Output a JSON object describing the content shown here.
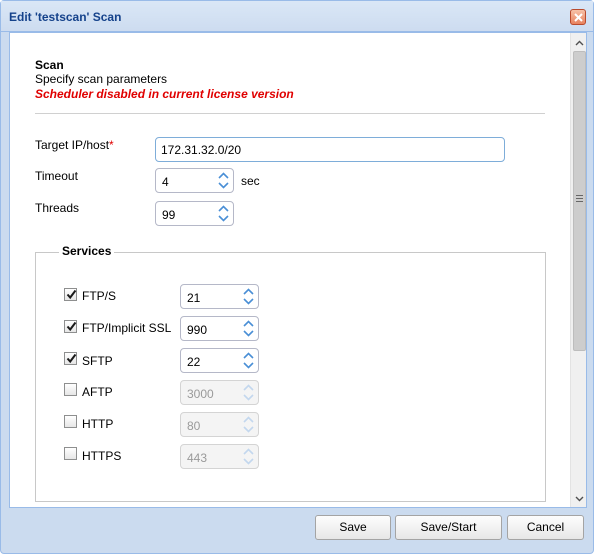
{
  "window": {
    "title": "Edit 'testscan' Scan"
  },
  "header": {
    "heading": "Scan",
    "description": "Specify scan parameters",
    "warning": "Scheduler disabled in current license version"
  },
  "fields": {
    "target_label": "Target IP/host",
    "target_required": "*",
    "target_value": "172.31.32.0/20",
    "timeout_label": "Timeout",
    "timeout_value": "4",
    "timeout_unit": "sec",
    "threads_label": "Threads",
    "threads_value": "99"
  },
  "services": {
    "legend": "Services",
    "items": [
      {
        "label": "FTP/S",
        "checked": true,
        "port": "21",
        "enabled": true
      },
      {
        "label": "FTP/Implicit SSL",
        "checked": true,
        "port": "990",
        "enabled": true
      },
      {
        "label": "SFTP",
        "checked": true,
        "port": "22",
        "enabled": true
      },
      {
        "label": "AFTP",
        "checked": false,
        "port": "3000",
        "enabled": false
      },
      {
        "label": "HTTP",
        "checked": false,
        "port": "80",
        "enabled": false
      },
      {
        "label": "HTTPS",
        "checked": false,
        "port": "443",
        "enabled": false
      }
    ]
  },
  "buttons": {
    "save": "Save",
    "save_start": "Save/Start",
    "cancel": "Cancel"
  },
  "colors": {
    "title_text": "#15428b",
    "warning_text": "#e00000",
    "border_accent": "#99bbe8",
    "spinner_arrow": "#4a8fd6"
  },
  "icons": {
    "close": "close-icon",
    "checkbox_mark": "checkmark-icon",
    "spinner": "spinner-arrows-icon",
    "scroll_up": "scroll-up-icon",
    "scroll_down": "scroll-down-icon"
  }
}
